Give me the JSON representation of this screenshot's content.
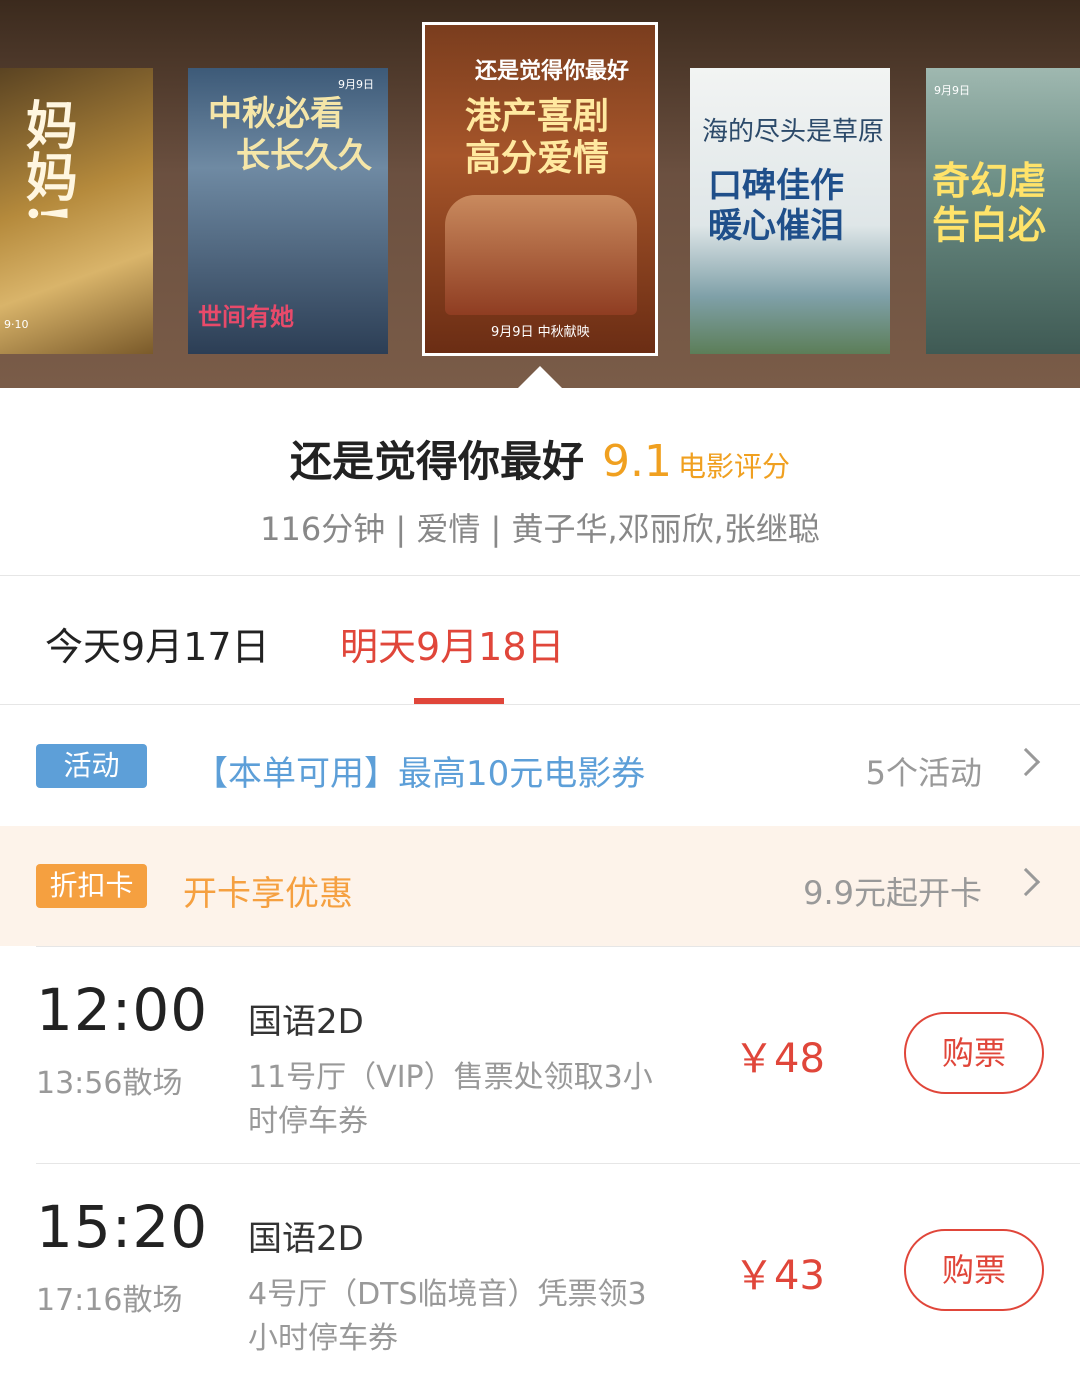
{
  "posters": [
    {
      "headline": "妈妈!",
      "date": "9·10"
    },
    {
      "headline_line1": "中秋必看",
      "headline_line2": "长长久久",
      "date": "9月9日",
      "subtitle": "世间有她"
    },
    {
      "title": "还是觉得你最好",
      "headline_line1": "港产喜剧",
      "headline_line2": "高分爱情",
      "release": "9月9日 中秋献映"
    },
    {
      "title": "海的尽头是草原",
      "headline_line1": "口碑佳作",
      "headline_line2": "暖心催泪"
    },
    {
      "headline_line1": "奇幻虐",
      "headline_line2": "告白必",
      "date": "9月9日"
    }
  ],
  "movie": {
    "title": "还是觉得你最好",
    "rating": "9.1",
    "rating_label": "电影评分",
    "meta": "116分钟 | 爱情 | 黄子华,邓丽欣,张继聪"
  },
  "date_tabs": {
    "today": "今天9月17日",
    "tomorrow": "明天9月18日"
  },
  "activity": {
    "tag": "活动",
    "text": "【本单可用】最高10元电影券",
    "right": "5个活动"
  },
  "discount_card": {
    "tag": "折扣卡",
    "text": "开卡享优惠",
    "right": "9.9元起开卡"
  },
  "showtimes": [
    {
      "start": "12:00",
      "end": "13:56散场",
      "version": "国语2D",
      "hall": "11号厅（VIP）售票处领取3小时停车券",
      "price": "￥48",
      "button": "购票"
    },
    {
      "start": "15:20",
      "end": "17:16散场",
      "version": "国语2D",
      "hall": "4号厅（DTS临境音）凭票领3小时停车券",
      "price": "￥43",
      "button": "购票"
    }
  ],
  "colors": {
    "accent": "#e0463a",
    "rating": "#f0a020",
    "activity": "#5d9fd8",
    "card": "#f5a040"
  }
}
